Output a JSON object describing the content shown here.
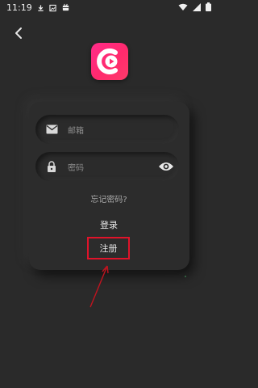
{
  "status_bar": {
    "time": "11:19",
    "left_icons": [
      "download-icon",
      "photo-icon",
      "bug-icon"
    ],
    "right_icons": [
      "wifi-icon",
      "signal-icon",
      "battery-icon"
    ]
  },
  "header": {
    "back_icon": "chevron-left-icon"
  },
  "logo": {
    "colors": [
      "#ff2b8a",
      "#ff2a6d"
    ]
  },
  "form": {
    "email": {
      "placeholder": "邮箱",
      "icon": "mail-icon"
    },
    "password": {
      "placeholder": "密码",
      "icon": "lock-icon",
      "toggle_icon": "eye-icon"
    },
    "forgot_password": "忘记密码?",
    "login_label": "登录",
    "register_label": "注册"
  },
  "annotation": {
    "highlight_color": "#e0132a"
  }
}
